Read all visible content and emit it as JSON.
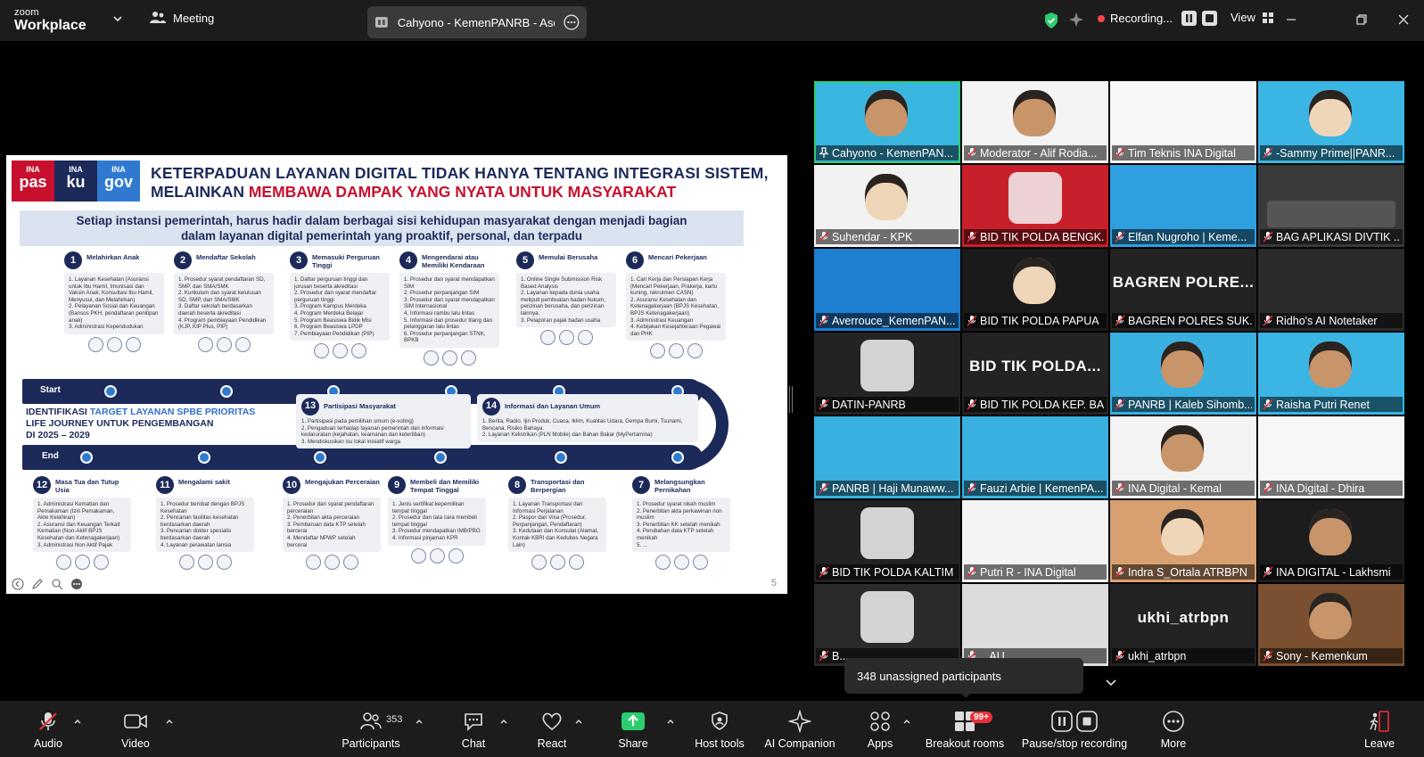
{
  "titlebar": {
    "logo_top": "zoom",
    "logo_bottom": "Workplace",
    "meeting_label": "Meeting",
    "speaker_pill": "Cahyono - KemenPANRB - Asdep",
    "recording_label": "Recording...",
    "view_label": "View"
  },
  "slide": {
    "brands": [
      {
        "top": "INA",
        "bottom": "pas",
        "color": "#c8102e"
      },
      {
        "top": "INA",
        "bottom": "ku",
        "color": "#1c2a5a"
      },
      {
        "top": "INA",
        "bottom": "gov",
        "color": "#2f7ad0"
      }
    ],
    "title_line1": "KETERPADUAN LAYANAN DIGITAL TIDAK HANYA TENTANG INTEGRASI SISTEM,",
    "title_line2_prefix": "MELAINKAN ",
    "title_line2_highlight": "MEMBAWA DAMPAK YANG NYATA UNTUK MASYARAKAT",
    "subtitle_line1": "Setiap instansi pemerintah, harus hadir dalam berbagai sisi kehidupan masyarakat dengan menjadi bagian",
    "subtitle_line2": "dalam  layanan digital pemerintah yang proaktif, personal, dan terpadu",
    "start_label": "Start",
    "end_label": "End",
    "ident_prefix": "IDENTIFIKASI ",
    "ident_highlight": "TARGET LAYANAN SPBE PRIORITAS",
    "ident_line2": "LIFE JOURNEY UNTUK PENGEMBANGAN",
    "ident_line3": "DI 2025 – 2029",
    "page_number": "5",
    "top_steps": [
      {
        "num": "1",
        "title": "Melahirkan Anak",
        "items": [
          "1. Layanan Kesehatan (Asuransi untuk Ibu Hamil, Imunisasi dan Vaksin Anak, Konsultasi Ibu Hamil, Menyusui, dan Melahirkan)",
          "2. Pelayanan Sosial dan Keuangan (Bansos PKH, pendaftaran penitipan anak)",
          "3. Administrasi Kependudukan"
        ]
      },
      {
        "num": "2",
        "title": "Mendaftar Sekolah",
        "items": [
          "1. Prosedur syarat pendaftaran SD, SMP, dan SMA/SMK",
          "2. Kurikulum dan syarat kelulusan SD, SMP, dan SMA/SMK",
          "3. Daftar sekolah berdasarkan daerah beserta akreditasi",
          "4. Program pembiayaan Pendidikan (KJP, KIP Plus, PIP)"
        ]
      },
      {
        "num": "3",
        "title": "Memasuki Perguruan Tinggi",
        "items": [
          "1. Daftar perguruan tinggi dan jurusan beserta akreditasi",
          "2. Prosedur dan syarat mendaftar perguruan tinggi",
          "3. Program Kampus Merdeka",
          "4. Program Merdeka Belajar",
          "5. Program Beasiswa Bidik Misi",
          "6. Program Beasiswa LPDP",
          "7. Pembiayaan Pendidikan (PIP)"
        ]
      },
      {
        "num": "4",
        "title": "Mengendarai atau Memiliki Kendaraan",
        "items": [
          "1. Prosedur dan syarat mendapatkan SIM",
          "2. Prosedur perpanjangan SIM",
          "3. Prosedur dan syarat mendapatkan SIM Internasional",
          "4. Informasi rambu lalu lintas",
          "5. Informasi dan prosedur tilang dan pelanggaran lalu lintas",
          "6. Prosedur perpanjangan STNK, BPKB"
        ]
      },
      {
        "num": "5",
        "title": "Memulai Berusaha",
        "items": [
          "1. Online Single Submission Risk Based Analysis",
          "2. Layanan kepada dunia usaha meliputi pembuatan badan hukum, perizinan berusaha, dan perizinan lainnya.",
          "3. Pelaporan pajak badan usaha"
        ]
      },
      {
        "num": "6",
        "title": "Mencari Pekerjaan",
        "items": [
          "1. Cari Kerja dan Persiapan Kerja (Mencari Pekerjaan, Prakerja, kartu kuning, rekrutmen CASN)",
          "2. Asuransi Kesehatan dan Ketenagakerjaan (BPJS Kesehatan, BPJS Ketenagakerjaan)",
          "3. Administrasi Keuangan",
          "4. Kebijakan Kesejahteraan Pegawai dan PHK"
        ]
      }
    ],
    "mid_steps": [
      {
        "num": "13",
        "title": "Partisipasi Masyarakat",
        "items": [
          "1. Partisipasi pada pemilihan umum (e-voting)",
          "2. Pengaduan terhadap layanan pemerintah dan informasi kedaruratan (kejahatan, keamanan dan ketertiban)",
          "3. Mendiskusikan isu lokal inisiatif warga"
        ]
      },
      {
        "num": "14",
        "title": "Informasi dan Layanan Umum",
        "items": [
          "1. Berita, Radio, Ijin Produk, Cuaca, Iklim, Kualitas Udara, Gempa Bumi, Tsunami, Bencana, Risiko Bahaya.",
          "2. Layanan Kelistrikan (PLN Mobile) dan Bahan Bakar (MyPertamina)"
        ]
      }
    ],
    "bottom_steps": [
      {
        "num": "12",
        "title": "Masa Tua dan Tutup Usia",
        "items": [
          "1. Administrasi Kematian dan Pemakaman (Izin Pemakaman, Akte Kelahiran)",
          "2. Asuransi dan Keuangan Terkait Kematian (Non-Aktif BPJS Kesehatan dan Ketenagakerjaan)",
          "3. Administrasi Non Aktif Pajak"
        ]
      },
      {
        "num": "11",
        "title": "Mengalami sakit",
        "items": [
          "1. Prosedur berobat dengan BPJS Kesehatan",
          "2. Pencarian fasilitas kesehatan berdasarkan daerah",
          "3. Pencarian dokter spesialis berdasarkan daerah",
          "4. Layanan perawatan lansia"
        ]
      },
      {
        "num": "10",
        "title": "Mengajukan Perceraian",
        "items": [
          "1. Prosedur dan syarat pendaftaran perceraian",
          "2. Penerbitan akta perceraian",
          "3. Pembaruan data KTP setelah bercerai",
          "4. Mendaftar NPWP setelah bercerai"
        ]
      },
      {
        "num": "9",
        "title": "Membeli dan Memiliki Tempat Tinggal",
        "items": [
          "1. Jenis sertifikat kepemilikan tempat tinggal",
          "2. Prosedur dan tata cara membeli tempat tinggal",
          "3. Prosedur mendapatkan IMB/PBG",
          "4. Informasi pinjaman KPR"
        ]
      },
      {
        "num": "8",
        "title": "Transportasi dan Berpergian",
        "items": [
          "1. Layanan Transportasi dan Informasi Perjalanan",
          "2. Paspor dan Visa (Prosedur, Perpanjangan, Pendaftaran)",
          "3. Kedutaan dan Konsulat (Alamat, Kontak KBRI dan Kedubes Negara Lain)"
        ]
      },
      {
        "num": "7",
        "title": "Melangsungkan Pernikahan",
        "items": [
          "1. Prosedur syarat nikah muslim",
          "2. Penerbitan akta perkawinan non muslim",
          "3. Penerbitan KK setelah menikah",
          "4. Perubahan data KTP setelah menikah",
          "5. ..."
        ]
      }
    ]
  },
  "gallery": {
    "participants": [
      {
        "name": "Cahyono - KemenPAN...",
        "muted": false,
        "pinned": true,
        "active": true,
        "bg": "#39b6e0",
        "kind": "person"
      },
      {
        "name": "Moderator - Alif Rodia...",
        "muted": true,
        "bg": "#f4f4f4",
        "kind": "person"
      },
      {
        "name": "Tim Teknis INA Digital",
        "muted": true,
        "bg": "#f7f7f7",
        "kind": "blank"
      },
      {
        "name": "-Sammy Prime||PANR...",
        "muted": true,
        "bg": "#3bb5e4",
        "kind": "avatar"
      },
      {
        "name": "Suhendar - KPK",
        "muted": true,
        "bg": "#f2f2f2",
        "kind": "avatar"
      },
      {
        "name": "BID TIK POLDA BENGK...",
        "muted": true,
        "bg": "#c8202a",
        "kind": "logo"
      },
      {
        "name": "Elfan Nugroho | Keme...",
        "muted": true,
        "bg": "#2f9fe0",
        "kind": "blank"
      },
      {
        "name": "BAG APLIKASI DIVTIK ...",
        "muted": true,
        "bg": "#3a3a3a",
        "kind": "group"
      },
      {
        "name": "Averrouce_KemenPAN...",
        "muted": true,
        "bg": "#1f7fd0",
        "kind": "blank"
      },
      {
        "name": "BID TIK POLDA PAPUA",
        "muted": true,
        "bg": "#1a1a1a",
        "kind": "avatar"
      },
      {
        "name": "BAGREN POLRES SUK...",
        "muted": true,
        "bg": "#232323",
        "kind": "text",
        "big": "BAGREN  POLRE..."
      },
      {
        "name": "Ridho's AI Notetaker",
        "muted": true,
        "bg": "#2b2b2b",
        "kind": "blank"
      },
      {
        "name": "DATIN-PANRB",
        "muted": true,
        "bg": "#232323",
        "kind": "logo"
      },
      {
        "name": "BID TIK POLDA KEP. BA...",
        "muted": true,
        "bg": "#232323",
        "kind": "text",
        "big": "BID TIK POLDA..."
      },
      {
        "name": "PANRB | Kaleb Sihomb...",
        "muted": true,
        "bg": "#3ab0e0",
        "kind": "person"
      },
      {
        "name": "Raisha Putri Renet",
        "muted": true,
        "bg": "#3bb5e4",
        "kind": "person"
      },
      {
        "name": "PANRB | Haji Munaww...",
        "muted": true,
        "bg": "#3ab0e0",
        "kind": "blank"
      },
      {
        "name": "Fauzi Arbie | KemenPA...",
        "muted": true,
        "bg": "#3ab0e0",
        "kind": "blank"
      },
      {
        "name": "INA Digital - Kemal",
        "muted": true,
        "bg": "#f4f4f4",
        "kind": "person"
      },
      {
        "name": "INA Digital - Dhira",
        "muted": true,
        "bg": "#f7f7f7",
        "kind": "blank"
      },
      {
        "name": "BID TIK POLDA KALTIM",
        "muted": true,
        "bg": "#222",
        "kind": "logo"
      },
      {
        "name": "Putri R - INA Digital",
        "muted": true,
        "bg": "#f4f4f4",
        "kind": "blank"
      },
      {
        "name": "Indra S_Ortala ATRBPN",
        "muted": true,
        "bg": "#d8a070",
        "kind": "avatar"
      },
      {
        "name": "INA DIGITAL - Lakhsmi",
        "muted": true,
        "bg": "#1c1c1c",
        "kind": "person"
      },
      {
        "name": "B...",
        "muted": true,
        "bg": "#2a2a2a",
        "kind": "logo"
      },
      {
        "name": "...AU",
        "muted": true,
        "bg": "#dcdcdc",
        "kind": "blank"
      },
      {
        "name": "ukhi_atrbpn",
        "muted": true,
        "bg": "#232323",
        "kind": "text",
        "big": "ukhi_atrbpn"
      },
      {
        "name": "Sony - Kemenkum",
        "muted": true,
        "bg": "#7a5030",
        "kind": "person"
      }
    ],
    "popover_text": "348 unassigned participants"
  },
  "toolbar": {
    "audio": "Audio",
    "video": "Video",
    "participants": "Participants",
    "participants_count": "353",
    "chat": "Chat",
    "react": "React",
    "share": "Share",
    "host_tools": "Host tools",
    "ai_companion": "AI Companion",
    "apps": "Apps",
    "breakout_rooms": "Breakout rooms",
    "breakout_badge": "99+",
    "pause_recording": "Pause/stop recording",
    "more": "More",
    "leave": "Leave"
  },
  "colors": {
    "share_green": "#2ecc71",
    "mute_red": "#e8303a",
    "leave_red": "#e8303a"
  }
}
